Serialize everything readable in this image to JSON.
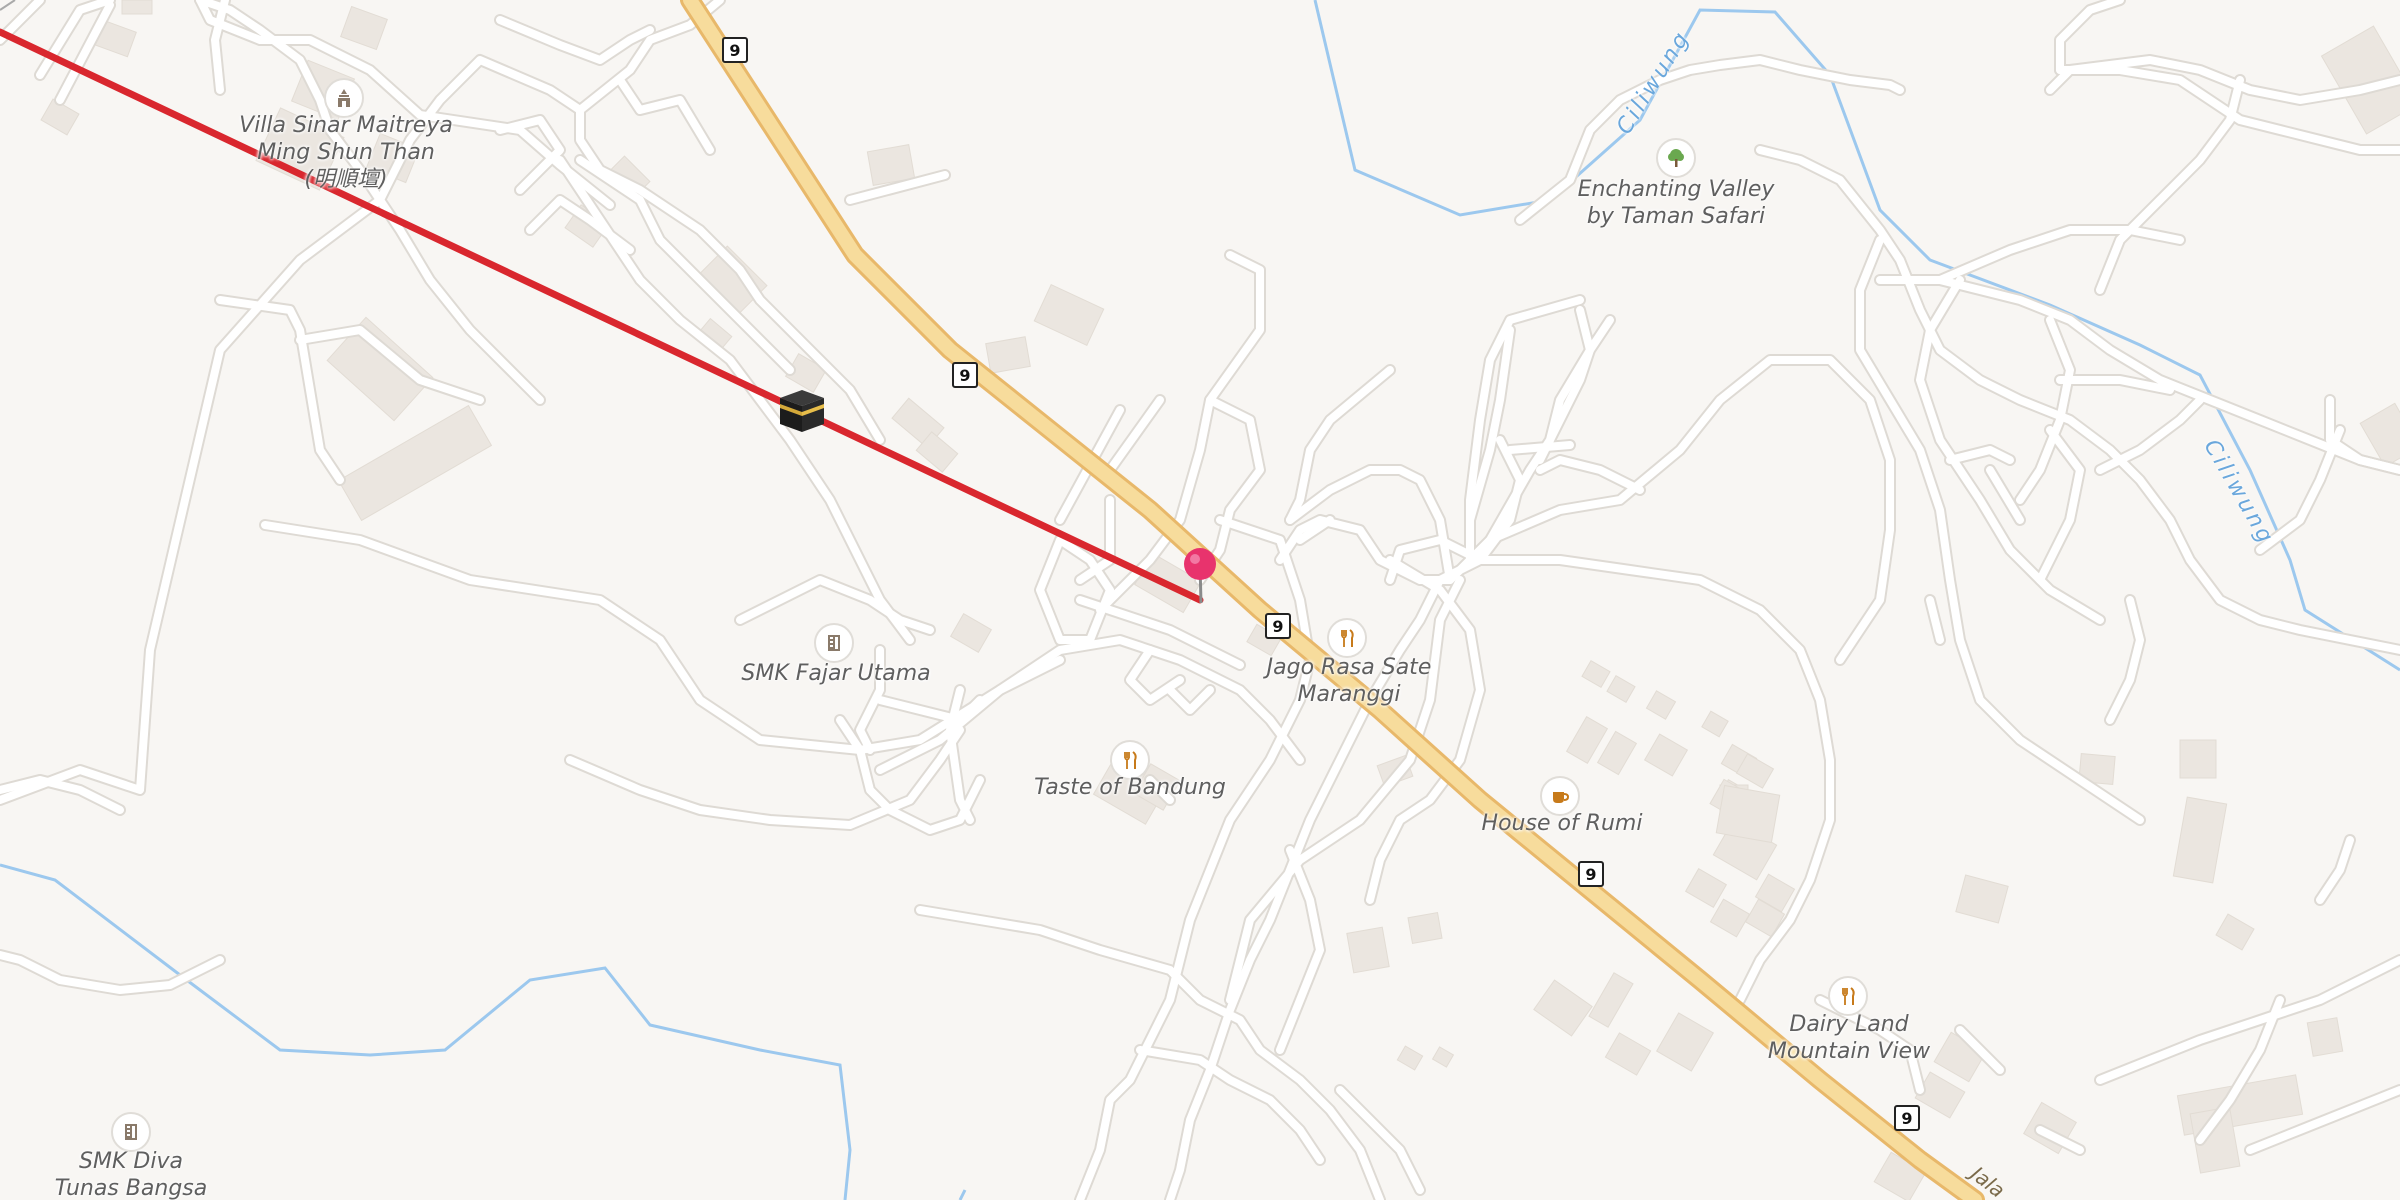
{
  "map": {
    "pois": [
      {
        "id": "villa",
        "icon": "temple-icon",
        "label_lines": [
          "Villa Sinar Maitreya",
          "Ming Shun Than",
          "(明順壇)"
        ]
      },
      {
        "id": "enchanting",
        "icon": "park-tree-icon",
        "label_lines": [
          "Enchanting Valley",
          "by Taman Safari"
        ]
      },
      {
        "id": "smk-fajar",
        "icon": "school-icon",
        "label_lines": [
          "SMK Fajar Utama"
        ]
      },
      {
        "id": "jago-rasa",
        "icon": "restaurant-icon",
        "label_lines": [
          "Jago Rasa Sate",
          "Maranggi"
        ]
      },
      {
        "id": "taste-bandung",
        "icon": "restaurant-icon",
        "label_lines": [
          "Taste of Bandung"
        ]
      },
      {
        "id": "house-rumi",
        "icon": "cafe-icon",
        "label_lines": [
          "House of Rumi"
        ]
      },
      {
        "id": "dairy-land",
        "icon": "restaurant-icon",
        "label_lines": [
          "Dairy Land",
          "Mountain View"
        ]
      },
      {
        "id": "smk-diva",
        "icon": "school-icon",
        "label_lines": [
          "SMK Diva",
          "Tunas Bangsa"
        ]
      }
    ],
    "route_shields": [
      "9",
      "9",
      "9",
      "9",
      "9"
    ],
    "water_labels": [
      "Ciliwung",
      "Ciliwung"
    ],
    "road_label": "Jala",
    "markers": {
      "pin_icon": "location-pin-icon",
      "kaaba_icon": "kaaba-icon"
    },
    "colors": {
      "background": "#f8f6f3",
      "road": "#ffffff",
      "road_casing": "#dedad4",
      "highway": "#f7dc9c",
      "highway_casing": "#e8b86a",
      "water": "#9cc8ee",
      "building": "#ebe6e0",
      "qibla_line": "#d9272e",
      "pin": "#e8336d",
      "poi_icon": "#8a7a6a",
      "food_icon": "#c77a1a",
      "park_icon": "#6aa84f"
    }
  }
}
